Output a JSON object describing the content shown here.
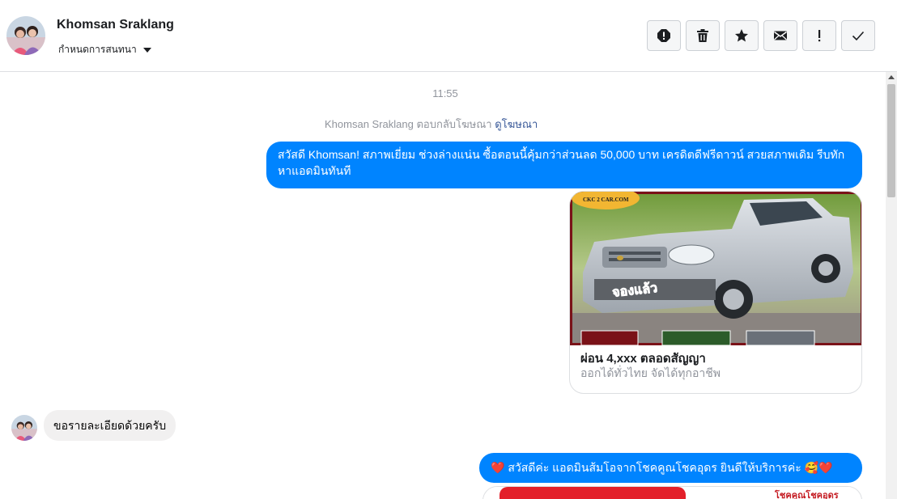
{
  "header": {
    "contact_name": "Khomsan Sraklang",
    "sub_label": "กำหนดการสนทนา",
    "actions": [
      "spam-icon",
      "trash-icon",
      "star-icon",
      "mail-icon",
      "exclamation-icon",
      "check-icon"
    ]
  },
  "thread": {
    "timestamp": "11:55",
    "reply_note": "Khomsan Sraklang ตอบกลับโฆษณา",
    "reply_note_link": "ดูโฆษณา",
    "messages": [
      {
        "text": "สวัสดี Khomsan!  สภาพเยี่ยม ช่วงล่างแน่น  ซื้อตอนนี้คุ้มกว่าส่วนลด 50,000 บาท เครดิตดีฟรีดาวน์  สวยสภาพเดิม รีบทักหาแอดมินทันที"
      },
      {
        "ad_card": {
          "logo_text": "CKC 2 CAR.COM",
          "stamp_text": "จองแล้ว",
          "title": "ผ่อน 4,xxx ตลอดสัญญา",
          "description": "ออกได้ทั่วไทย จัดได้ทุกอาชีพ"
        }
      },
      {
        "text": "ขอรายละเอียดด้วยครับ"
      },
      {
        "text": "❤️ สวัสดีค่ะ แอดมินส้มโอจากโชคคูณโชคอุดร ยินดีให้บริการค่ะ 🥰❤️",
        "card_text": "โชคคูณโชคอุดร"
      }
    ]
  },
  "colors": {
    "outgoing": "#0084ff",
    "incoming": "#f1f0f0",
    "meta": "#90949c",
    "link": "#385898"
  }
}
